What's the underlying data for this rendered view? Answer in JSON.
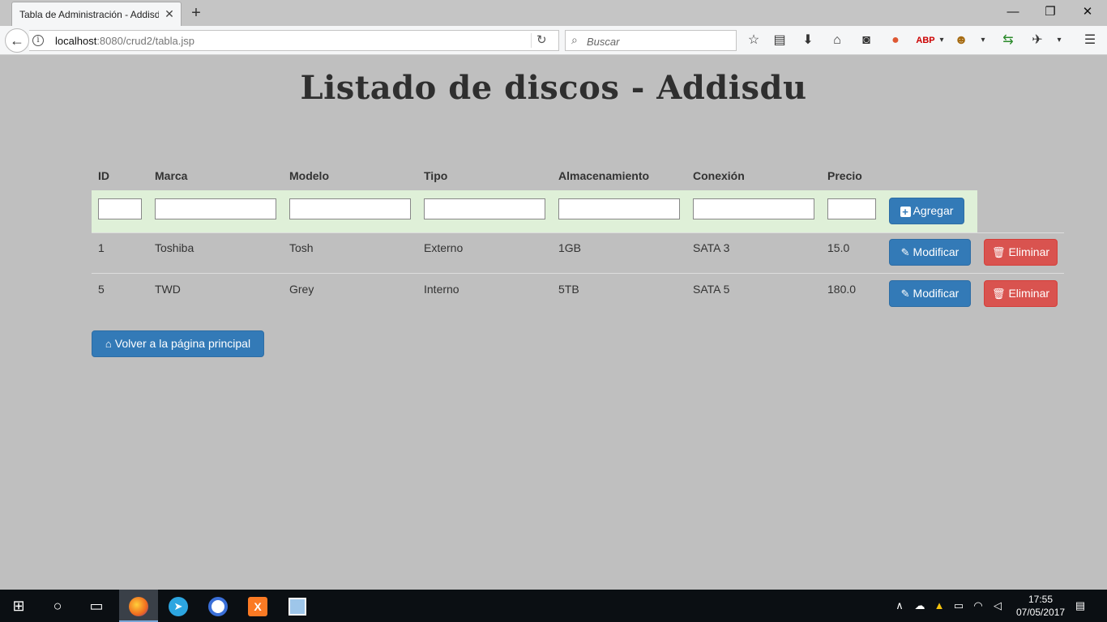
{
  "browser": {
    "tab_title": "Tabla de Administración - Addisdu",
    "url_host": "localhost",
    "url_rest": ":8080/crud2/tabla.jsp",
    "search_placeholder": "Buscar"
  },
  "page": {
    "title": "Listado de discos - Addisdu",
    "columns": [
      "ID",
      "Marca",
      "Modelo",
      "Tipo",
      "Almacenamiento",
      "Conexión",
      "Precio"
    ],
    "add_button": "Agregar",
    "rows": [
      {
        "id": "1",
        "marca": "Toshiba",
        "modelo": "Tosh",
        "tipo": "Externo",
        "almacenamiento": "1GB",
        "conexion": "SATA 3",
        "precio": "15.0"
      },
      {
        "id": "5",
        "marca": "TWD",
        "modelo": "Grey",
        "tipo": "Interno",
        "almacenamiento": "5TB",
        "conexion": "SATA 5",
        "precio": "180.0"
      }
    ],
    "modify_button": "Modificar",
    "delete_button": "Eliminar",
    "back_button": "Volver a la página principal"
  },
  "taskbar": {
    "time": "17:55",
    "date": "07/05/2017"
  },
  "colors": {
    "primary": "#337ab7",
    "danger": "#d9534f",
    "add_row": "#dff0d8",
    "background": "#bfbfbf"
  },
  "icons": [
    "back-arrow-icon",
    "info-icon",
    "reload-icon",
    "search-icon",
    "star-icon",
    "reader-icon",
    "download-icon",
    "home-icon",
    "pocket-icon",
    "duckduckgo-icon",
    "adblock-icon",
    "greasemonkey-icon",
    "plus-square-icon",
    "edit-icon",
    "trash-icon",
    "home-icon",
    "windows-start-icon",
    "notification-icon"
  ]
}
